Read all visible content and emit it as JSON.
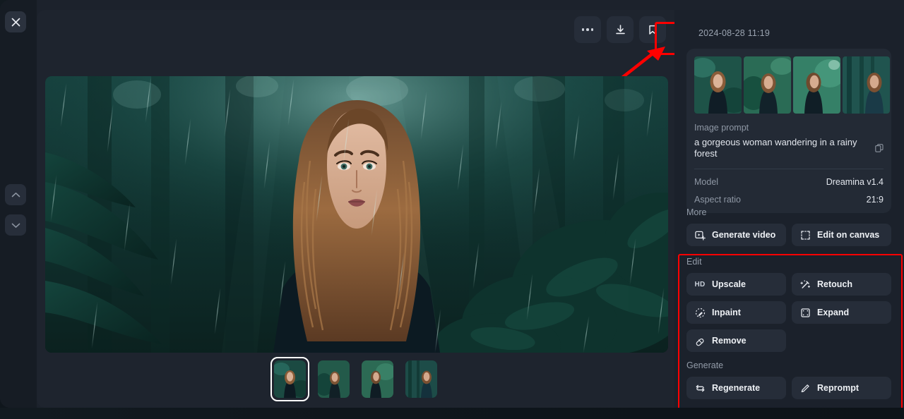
{
  "app": {
    "background_color": "#1e242e",
    "panel_color": "#1b212b",
    "accent_highlight_color": "#ff0000"
  },
  "left_rail": {
    "close_label": "Close",
    "prev_label": "Previous image",
    "next_label": "Next image"
  },
  "toolbar": {
    "more_label": "More options",
    "download_label": "Download",
    "bookmark_label": "Save to collection"
  },
  "viewer": {
    "image_alt": "a gorgeous woman wandering in a rainy forest",
    "thumbnails": [
      {
        "selected": true,
        "alt": "variation 1"
      },
      {
        "selected": false,
        "alt": "variation 2"
      },
      {
        "selected": false,
        "alt": "variation 3"
      },
      {
        "selected": false,
        "alt": "variation 4"
      }
    ]
  },
  "details": {
    "timestamp": "2024-08-28 11:19",
    "preview_count": 4,
    "image_prompt_label": "Image prompt",
    "image_prompt": "a gorgeous woman wandering in a rainy forest",
    "copy_icon": "copy-icon",
    "model_label": "Model",
    "model_value": "Dreamina v1.4",
    "aspect_ratio_label": "Aspect ratio",
    "aspect_ratio_value": "21:9"
  },
  "sections": {
    "more": {
      "title": "More",
      "buttons": [
        {
          "label": "Generate video",
          "icon": "video-plus-icon"
        },
        {
          "label": "Edit on canvas",
          "icon": "crop-frame-icon"
        }
      ]
    },
    "edit": {
      "title": "Edit",
      "highlighted": true,
      "buttons": [
        {
          "label": "Upscale",
          "icon": "hd-icon"
        },
        {
          "label": "Retouch",
          "icon": "magic-wand-icon"
        },
        {
          "label": "Inpaint",
          "icon": "brush-circle-icon"
        },
        {
          "label": "Expand",
          "icon": "expand-frame-icon"
        },
        {
          "label": "Remove",
          "icon": "eraser-icon"
        }
      ]
    },
    "generate": {
      "title": "Generate",
      "buttons": [
        {
          "label": "Regenerate",
          "icon": "refresh-icon"
        },
        {
          "label": "Reprompt",
          "icon": "pencil-icon"
        }
      ]
    }
  }
}
